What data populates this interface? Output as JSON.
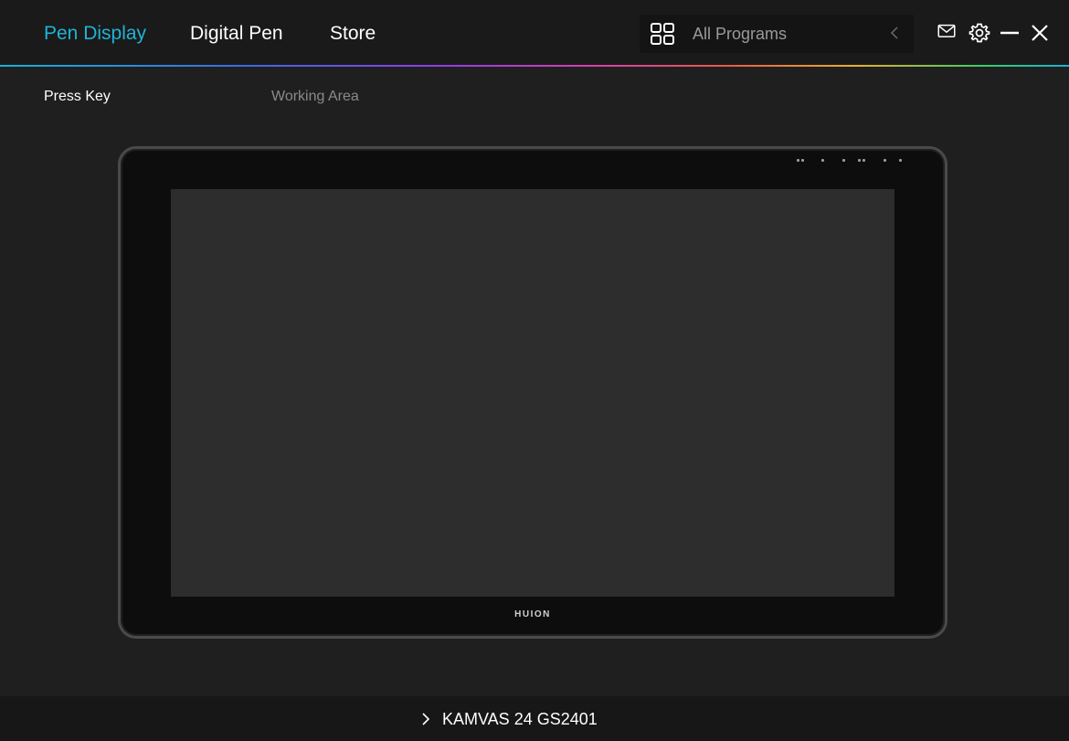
{
  "header": {
    "tabs": [
      {
        "label": "Pen Display",
        "active": true
      },
      {
        "label": "Digital Pen",
        "active": false
      },
      {
        "label": "Store",
        "active": false
      }
    ],
    "program_select": {
      "label": "All Programs",
      "icon": "grid-icon"
    },
    "window_icons": [
      "mail-icon",
      "gear-icon",
      "minimize-icon",
      "close-icon"
    ]
  },
  "subtabs": [
    {
      "label": "Press Key",
      "active": true
    },
    {
      "label": "Working Area",
      "active": false
    }
  ],
  "device": {
    "brand": "HUION"
  },
  "footer": {
    "device_name": "KAMVAS 24 GS2401"
  },
  "colors": {
    "accent": "#1fb3d6",
    "background": "#1f1f1f",
    "topbar": "#1a1a1a",
    "screen": "#2d2d2d"
  }
}
